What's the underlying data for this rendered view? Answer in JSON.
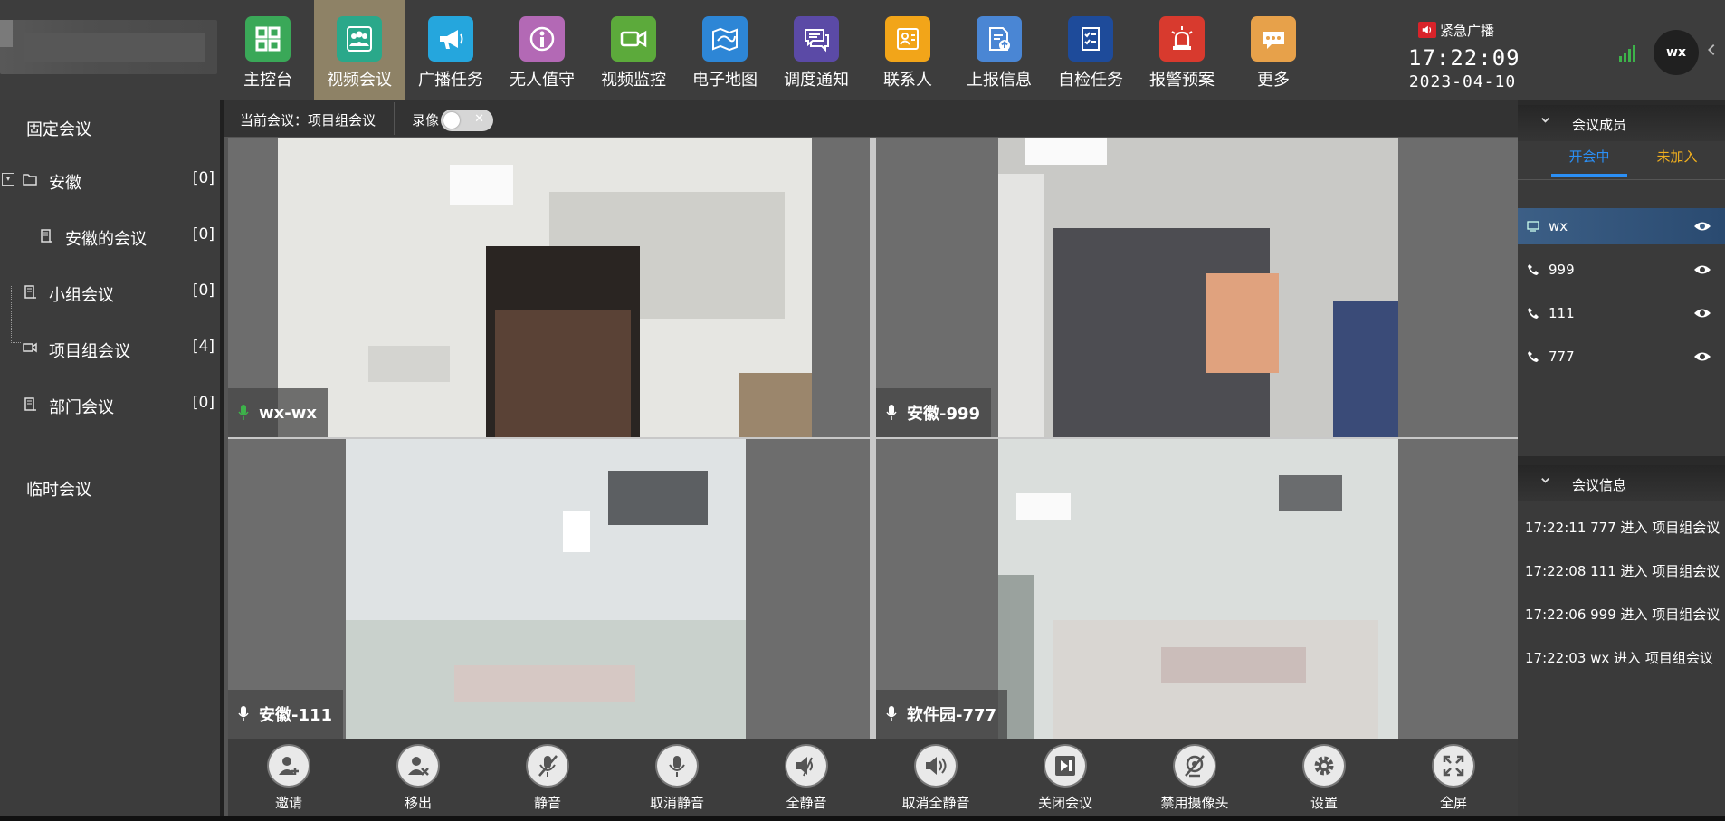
{
  "nav": {
    "items": [
      {
        "label": "主控台",
        "icon": "dashboard-grid-icon",
        "color": "#3aa858"
      },
      {
        "label": "视频会议",
        "icon": "video-meeting-icon",
        "color": "#2aa88a",
        "active": true
      },
      {
        "label": "广播任务",
        "icon": "megaphone-icon",
        "color": "#25a6dd"
      },
      {
        "label": "无人值守",
        "icon": "unattended-icon",
        "color": "#b369b5"
      },
      {
        "label": "视频监控",
        "icon": "video-camera-icon",
        "color": "#5caa3b"
      },
      {
        "label": "电子地图",
        "icon": "map-icon",
        "color": "#2d86d6"
      },
      {
        "label": "调度通知",
        "icon": "chat-notice-icon",
        "color": "#5b4aa6"
      },
      {
        "label": "联系人",
        "icon": "contacts-icon",
        "color": "#f2a519"
      },
      {
        "label": "上报信息",
        "icon": "report-upload-icon",
        "color": "#4a86d4"
      },
      {
        "label": "自检任务",
        "icon": "checklist-icon",
        "color": "#1e4b9a"
      },
      {
        "label": "报警预案",
        "icon": "alarm-light-icon",
        "color": "#d83a2e"
      },
      {
        "label": "更多",
        "icon": "more-icon",
        "color": "#e7a14a"
      }
    ]
  },
  "header": {
    "emergency_label": "紧急广播",
    "time": "17:22:09",
    "date": "2023-04-10",
    "user": "wx"
  },
  "sidebar": {
    "fixed_title": "固定会议",
    "temp_title": "临时会议",
    "items": [
      {
        "label": "安徽",
        "count": "[0]"
      },
      {
        "label": "安徽的会议",
        "count": "[0]"
      },
      {
        "label": "小组会议",
        "count": "[0]"
      },
      {
        "label": "项目组会议",
        "count": "[4]"
      },
      {
        "label": "部门会议",
        "count": "[0]"
      }
    ]
  },
  "meeting": {
    "current": "当前会议：项目组会议",
    "record_label": "录像",
    "record_on": false,
    "tiles": [
      {
        "name": "wx-wx",
        "mic_color": "#3db34a"
      },
      {
        "name": "安徽-999",
        "mic_color": "#ffffff"
      },
      {
        "name": "安徽-111",
        "mic_color": "#ffffff"
      },
      {
        "name": "软件园-777",
        "mic_color": "#ffffff"
      }
    ]
  },
  "controls": [
    {
      "label": "邀请",
      "icon": "invite-user-icon"
    },
    {
      "label": "移出",
      "icon": "remove-user-icon"
    },
    {
      "label": "静音",
      "icon": "mic-mute-icon"
    },
    {
      "label": "取消静音",
      "icon": "mic-icon"
    },
    {
      "label": "全静音",
      "icon": "speaker-mute-all-icon"
    },
    {
      "label": "取消全静音",
      "icon": "speaker-unmute-all-icon"
    },
    {
      "label": "关闭会议",
      "icon": "end-meeting-icon"
    },
    {
      "label": "禁用摄像头",
      "icon": "camera-off-icon"
    },
    {
      "label": "设置",
      "icon": "gear-icon"
    },
    {
      "label": "全屏",
      "icon": "fullscreen-icon"
    }
  ],
  "members_panel": {
    "title": "会议成员",
    "tab_active": "开会中",
    "tab_not_joined": "未加入",
    "members": [
      {
        "name": "wx",
        "type": "pc",
        "selected": true
      },
      {
        "name": "999",
        "type": "phone"
      },
      {
        "name": "111",
        "type": "phone"
      },
      {
        "name": "777",
        "type": "phone"
      }
    ]
  },
  "info_panel": {
    "title": "会议信息",
    "logs": [
      "17:22:11  777 进入 项目组会议",
      "17:22:08  111 进入 项目组会议",
      "17:22:06  999 进入 项目组会议",
      "17:22:03  wx 进入 项目组会议"
    ]
  },
  "colors": {
    "accent_blue": "#2b8ff5",
    "accent_yellow": "#f2b01e",
    "active_nav": "#8e8266"
  }
}
